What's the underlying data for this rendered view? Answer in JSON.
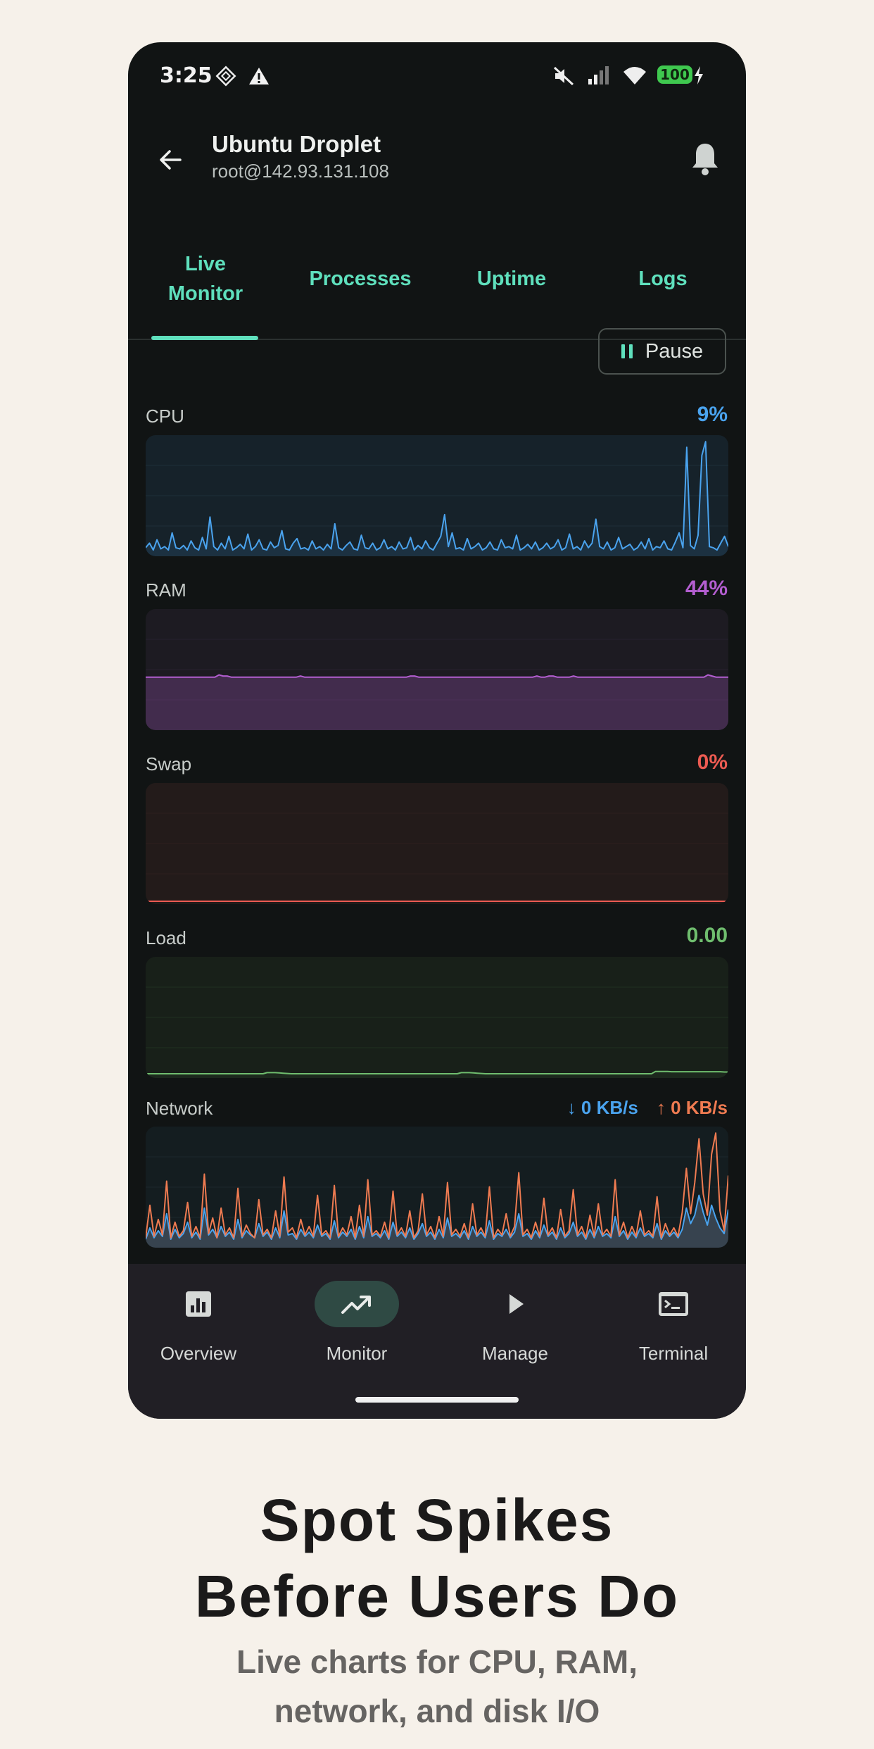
{
  "status_bar": {
    "time": "3:25",
    "battery": "100",
    "icons": [
      "tracker-icon",
      "warning-icon",
      "mute-icon",
      "signal-icon",
      "wifi-icon",
      "charging-icon"
    ]
  },
  "header": {
    "title": "Ubuntu Droplet",
    "subtitle": "root@142.93.131.108",
    "back_icon": "arrow-left-icon",
    "notif_icon": "bell-icon"
  },
  "tabs": [
    {
      "label": "Live\nMonitor",
      "active": true
    },
    {
      "label": "Processes",
      "active": false
    },
    {
      "label": "Uptime",
      "active": false
    },
    {
      "label": "Logs",
      "active": false
    }
  ],
  "pause_label": "Pause",
  "colors": {
    "accent": "#5fe0bd",
    "cpu": "#4aa3ee",
    "ram": "#b35ed0",
    "swap": "#ec5b52",
    "load": "#6fbd6e",
    "net_down": "#4aa3ee",
    "net_up": "#ef7b51"
  },
  "metrics": {
    "cpu": {
      "label": "CPU",
      "value": "9%"
    },
    "ram": {
      "label": "RAM",
      "value": "44%"
    },
    "swap": {
      "label": "Swap",
      "value": "0%"
    },
    "load": {
      "label": "Load",
      "value": "0.00"
    },
    "network": {
      "label": "Network",
      "down": "↓ 0 KB/s",
      "up": "↑ 0 KB/s"
    }
  },
  "chart_data": [
    {
      "type": "area",
      "name": "cpu",
      "ylim": [
        0,
        10
      ],
      "values": [
        0.5,
        0.9,
        0.3,
        1.2,
        0.4,
        0.6,
        0.3,
        1.8,
        0.5,
        0.4,
        0.7,
        0.3,
        1.1,
        0.5,
        0.3,
        1.4,
        0.4,
        3.2,
        0.6,
        0.3,
        0.9,
        0.4,
        1.5,
        0.3,
        0.5,
        0.8,
        0.4,
        1.7,
        0.3,
        0.6,
        1.2,
        0.4,
        0.3,
        1.0,
        0.5,
        0.7,
        2.0,
        0.4,
        0.3,
        0.9,
        1.3,
        0.4,
        0.5,
        0.3,
        1.1,
        0.4,
        0.6,
        0.3,
        0.8,
        0.4,
        2.6,
        0.5,
        0.3,
        0.7,
        1.0,
        0.4,
        0.3,
        1.6,
        0.5,
        0.4,
        0.9,
        0.3,
        0.5,
        1.2,
        0.4,
        0.6,
        0.3,
        1.0,
        0.4,
        0.5,
        1.4,
        0.3,
        0.7,
        0.4,
        1.1,
        0.5,
        0.3,
        0.9,
        1.5,
        3.4,
        0.6,
        1.8,
        0.4,
        0.5,
        0.3,
        1.3,
        0.4,
        0.6,
        0.9,
        0.3,
        0.5,
        1.0,
        0.4,
        0.3,
        1.2,
        0.5,
        0.6,
        0.4,
        1.6,
        0.3,
        0.5,
        0.8,
        0.4,
        1.0,
        0.3,
        0.5,
        0.9,
        0.4,
        0.6,
        1.2,
        0.3,
        0.5,
        1.7,
        0.4,
        0.6,
        0.3,
        1.1,
        0.5,
        0.9,
        3.0,
        0.6,
        0.4,
        1.0,
        0.3,
        0.5,
        1.4,
        0.4,
        0.6,
        0.8,
        0.3,
        0.5,
        1.0,
        0.4,
        1.3,
        0.3,
        0.6,
        0.5,
        1.1,
        0.4,
        0.3,
        1.0,
        1.8,
        0.5,
        9.3,
        0.7,
        0.4,
        1.6,
        8.6,
        9.8,
        0.6,
        0.5,
        0.3,
        0.9,
        1.5,
        0.6
      ]
    },
    {
      "type": "area",
      "name": "ram",
      "ylim": [
        0,
        100
      ],
      "values": [
        44,
        44,
        44,
        44,
        44,
        44,
        44,
        44,
        44,
        44,
        44,
        44,
        44,
        44,
        44,
        44,
        44,
        44,
        46,
        45,
        45,
        44,
        44,
        44,
        44,
        44,
        44,
        44,
        44,
        44,
        44,
        44,
        44,
        44,
        44,
        44,
        44,
        44,
        45,
        44,
        44,
        44,
        44,
        44,
        44,
        44,
        44,
        44,
        44,
        44,
        44,
        44,
        44,
        44,
        44,
        44,
        44,
        44,
        44,
        44,
        44,
        44,
        44,
        44,
        44,
        45,
        45,
        44,
        44,
        44,
        44,
        44,
        44,
        44,
        44,
        44,
        44,
        44,
        44,
        44,
        44,
        44,
        44,
        44,
        44,
        44,
        44,
        44,
        44,
        44,
        44,
        44,
        44,
        44,
        44,
        44,
        45,
        44,
        44,
        45,
        45,
        44,
        44,
        44,
        44,
        45,
        44,
        44,
        44,
        44,
        44,
        44,
        44,
        44,
        44,
        44,
        44,
        44,
        44,
        44,
        44,
        44,
        44,
        44,
        44,
        44,
        44,
        44,
        44,
        44,
        44,
        44,
        44,
        44,
        44,
        44,
        44,
        44,
        46,
        45,
        44,
        44,
        44,
        44
      ]
    },
    {
      "type": "area",
      "name": "swap",
      "ylim": [
        0,
        100
      ],
      "values": [
        0,
        0,
        0,
        0,
        0,
        0,
        0,
        0,
        0,
        0,
        0,
        0,
        0,
        0,
        0,
        0,
        0,
        0,
        0,
        0
      ]
    },
    {
      "type": "line",
      "name": "load",
      "ylim": [
        0,
        4
      ],
      "values": [
        0.05,
        0.05,
        0.05,
        0.05,
        0.05,
        0.05,
        0.05,
        0.05,
        0.05,
        0.05,
        0.05,
        0.05,
        0.05,
        0.05,
        0.05,
        0.05,
        0.05,
        0.05,
        0.05,
        0.05,
        0.05,
        0.05,
        0.05,
        0.05,
        0.05,
        0.05,
        0.05,
        0.05,
        0.05,
        0.05,
        0.09,
        0.09,
        0.09,
        0.08,
        0.07,
        0.06,
        0.05,
        0.05,
        0.05,
        0.05,
        0.05,
        0.05,
        0.05,
        0.05,
        0.05,
        0.05,
        0.05,
        0.05,
        0.05,
        0.05,
        0.05,
        0.05,
        0.05,
        0.05,
        0.05,
        0.05,
        0.05,
        0.05,
        0.05,
        0.05,
        0.05,
        0.05,
        0.05,
        0.05,
        0.05,
        0.05,
        0.05,
        0.05,
        0.05,
        0.05,
        0.05,
        0.05,
        0.05,
        0.05,
        0.05,
        0.05,
        0.05,
        0.05,
        0.09,
        0.09,
        0.09,
        0.08,
        0.07,
        0.06,
        0.05,
        0.05,
        0.05,
        0.05,
        0.05,
        0.05,
        0.05,
        0.05,
        0.05,
        0.05,
        0.05,
        0.05,
        0.05,
        0.05,
        0.05,
        0.05,
        0.05,
        0.05,
        0.05,
        0.05,
        0.05,
        0.05,
        0.05,
        0.05,
        0.05,
        0.05,
        0.05,
        0.05,
        0.05,
        0.05,
        0.05,
        0.05,
        0.05,
        0.05,
        0.05,
        0.05,
        0.05,
        0.05,
        0.05,
        0.05,
        0.05,
        0.05,
        0.13,
        0.13,
        0.13,
        0.13,
        0.12,
        0.12,
        0.12,
        0.12,
        0.12,
        0.12,
        0.12,
        0.12,
        0.12,
        0.12,
        0.12,
        0.12,
        0.12,
        0.11,
        0.11
      ]
    },
    {
      "type": "area",
      "name": "network",
      "series": [
        {
          "name": "down",
          "values": [
            0.4,
            1.2,
            0.5,
            1.0,
            0.6,
            2.2,
            0.4,
            1.1,
            0.5,
            0.8,
            1.6,
            0.5,
            0.9,
            0.4,
            2.6,
            0.7,
            1.1,
            0.5,
            1.3,
            0.6,
            0.9,
            0.4,
            1.8,
            0.5,
            1.0,
            0.7,
            0.5,
            1.5,
            0.6,
            0.9,
            0.4,
            1.2,
            0.5,
            2.4,
            0.7,
            0.8,
            0.4,
            1.1,
            0.6,
            0.9,
            0.5,
            1.4,
            0.6,
            0.8,
            0.4,
            1.7,
            0.5,
            0.9,
            0.6,
            1.1,
            0.4,
            1.3,
            0.5,
            2.0,
            0.6,
            0.8,
            0.5,
            1.0,
            0.4,
            1.6,
            0.6,
            0.9,
            0.5,
            1.2,
            0.4,
            0.8,
            1.5,
            0.6,
            0.9,
            0.4,
            1.1,
            0.5,
            1.9,
            0.6,
            0.8,
            0.5,
            1.0,
            0.4,
            1.3,
            0.6,
            0.9,
            0.5,
            1.7,
            0.4,
            0.8,
            0.6,
            1.1,
            0.5,
            0.9,
            2.2,
            0.6,
            0.8,
            0.4,
            1.0,
            0.5,
            1.4,
            0.6,
            0.9,
            0.4,
            1.2,
            0.5,
            0.8,
            1.6,
            0.6,
            0.9,
            0.4,
            1.1,
            0.5,
            1.3,
            0.6,
            0.8,
            0.5,
            2.0,
            0.6,
            1.0,
            0.4,
            0.9,
            0.5,
            1.2,
            0.6,
            0.8,
            0.5,
            1.5,
            0.4,
            1.0,
            0.6,
            0.9,
            0.5,
            1.1,
            2.6,
            1.5,
            2.1,
            3.5,
            2.3,
            1.4,
            2.8,
            1.9,
            1.2,
            0.8,
            2.5
          ]
        },
        {
          "name": "up",
          "values": [
            0.5,
            2.8,
            0.6,
            1.8,
            0.7,
            4.5,
            0.5,
            1.6,
            0.6,
            1.0,
            3.0,
            0.6,
            1.3,
            0.5,
            5.0,
            0.8,
            1.9,
            0.5,
            2.6,
            0.7,
            1.2,
            0.5,
            4.0,
            0.6,
            1.4,
            0.8,
            0.5,
            3.2,
            0.7,
            1.1,
            0.5,
            2.4,
            0.6,
            4.8,
            0.9,
            1.2,
            0.5,
            1.8,
            0.7,
            1.3,
            0.6,
            3.5,
            0.7,
            1.0,
            0.5,
            4.2,
            0.6,
            1.2,
            0.7,
            2.0,
            0.5,
            2.8,
            0.6,
            4.6,
            0.7,
            1.0,
            0.6,
            1.6,
            0.5,
            3.8,
            0.7,
            1.2,
            0.6,
            2.4,
            0.5,
            1.0,
            3.6,
            0.7,
            1.3,
            0.5,
            2.0,
            0.6,
            4.4,
            0.7,
            1.1,
            0.6,
            1.5,
            0.5,
            2.9,
            0.7,
            1.2,
            0.6,
            4.1,
            0.5,
            1.1,
            0.7,
            2.2,
            0.6,
            1.3,
            5.1,
            0.7,
            1.1,
            0.5,
            1.6,
            0.6,
            3.3,
            0.7,
            1.2,
            0.5,
            2.5,
            0.6,
            1.0,
            3.9,
            0.7,
            1.3,
            0.5,
            2.1,
            0.6,
            2.9,
            0.7,
            1.1,
            0.6,
            4.6,
            0.7,
            1.6,
            0.5,
            1.3,
            0.6,
            2.4,
            0.7,
            1.0,
            0.6,
            3.4,
            0.5,
            1.5,
            0.7,
            1.2,
            0.6,
            2.3,
            5.4,
            2.2,
            4.4,
            7.5,
            3.6,
            2.1,
            6.4,
            7.9,
            2.4,
            1.0,
            4.9
          ]
        }
      ]
    }
  ],
  "bottom_nav": [
    {
      "label": "Overview",
      "icon": "bar-chart-icon",
      "active": false
    },
    {
      "label": "Monitor",
      "icon": "trending-up-icon",
      "active": true
    },
    {
      "label": "Manage",
      "icon": "play-icon",
      "active": false
    },
    {
      "label": "Terminal",
      "icon": "terminal-icon",
      "active": false
    }
  ],
  "marketing": {
    "headline_line1": "Spot Spikes",
    "headline_line2": "Before Users Do",
    "subline_line1": "Live charts for CPU, RAM,",
    "subline_line2": "network, and disk I/O"
  }
}
